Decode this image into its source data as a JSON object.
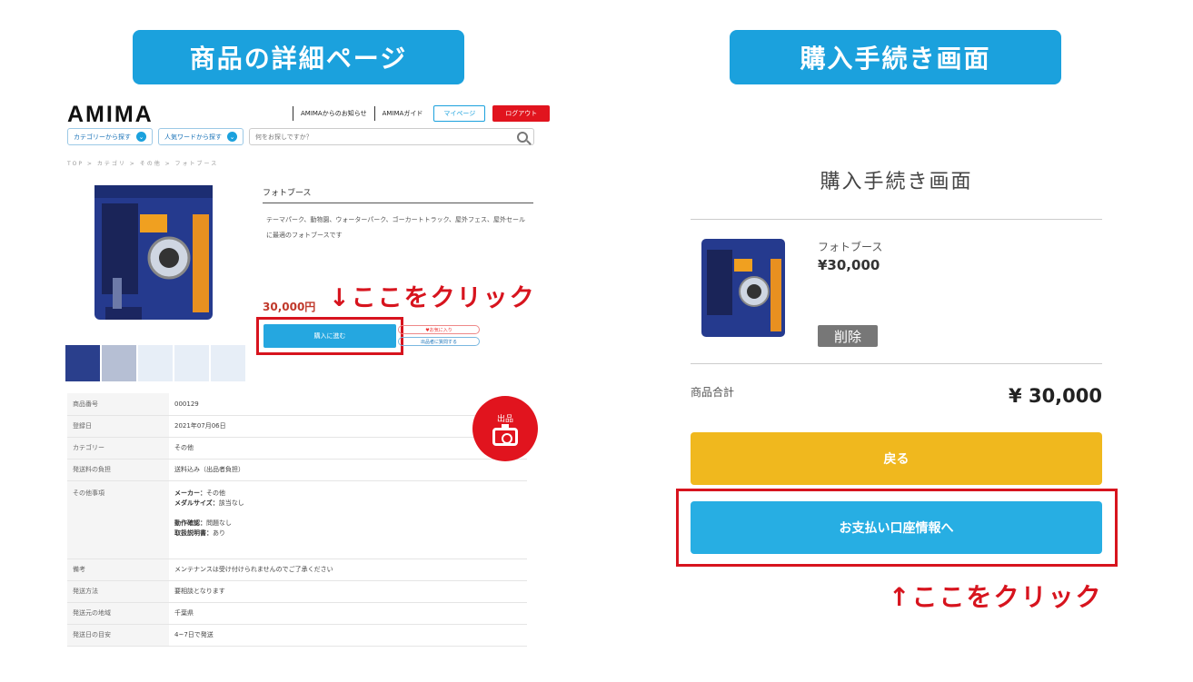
{
  "labels": {
    "left_heading": "商品の詳細ページ",
    "right_heading": "購入手続き画面",
    "callout_down": "↓ここをクリック",
    "callout_up": "↑ここをクリック"
  },
  "header": {
    "logo": "AMIMA",
    "nav_news": "AMIMAからのお知らせ",
    "nav_guide": "AMIMAガイド",
    "mypage": "マイページ",
    "logout": "ログアウト",
    "category_search": "カテゴリーから探す",
    "keyword_search": "人気ワードから探す",
    "search_placeholder": "何をお探しですか？",
    "breadcrumb": "TOP > カテゴリ > その他 > フォトブース"
  },
  "product": {
    "title": "フォトブース",
    "description": "テーマパーク、動物園、ウォーターパーク、ゴーカートトラック、屋外フェス、屋外セールに最適のフォトブースです",
    "price": "30,000円",
    "buy_button": "購入に進む",
    "favorite_button": "♥お気に入り",
    "ask_button": "出品者に質問する"
  },
  "spec": {
    "rows": [
      {
        "k": "商品番号",
        "v": "000129"
      },
      {
        "k": "登録日",
        "v": "2021年07月06日"
      },
      {
        "k": "カテゴリー",
        "v": "その他"
      },
      {
        "k": "発送料の負担",
        "v": "送料込み（出品者負担）"
      },
      {
        "k": "その他事項",
        "v": ""
      },
      {
        "k": "備考",
        "v": "メンテナンスは受け付けられませんのでご了承ください"
      },
      {
        "k": "発送方法",
        "v": "要相談となります"
      },
      {
        "k": "発送元の地域",
        "v": "千葉県"
      },
      {
        "k": "発送日の目安",
        "v": "4~7日で発送"
      }
    ],
    "other": {
      "maker_label": "メーカー：",
      "maker": "その他",
      "size_label": "メダルサイズ：",
      "size": "該当なし",
      "op_label": "動作確認：",
      "op": "問題なし",
      "manual_label": "取扱説明書：",
      "manual": "あり"
    }
  },
  "fab": {
    "label": "出品",
    "icon": "camera-icon"
  },
  "checkout": {
    "title": "購入手続き画面",
    "item_name": "フォトブース",
    "item_price": "¥30,000",
    "delete": "削除",
    "total_label": "商品合計",
    "total_value": "¥ 30,000",
    "back": "戻る",
    "pay": "お支払い口座情報へ"
  },
  "colors": {
    "brand_blue": "#1ba1dd",
    "accent_red": "#d7141e",
    "back_yellow": "#f0b81e"
  }
}
